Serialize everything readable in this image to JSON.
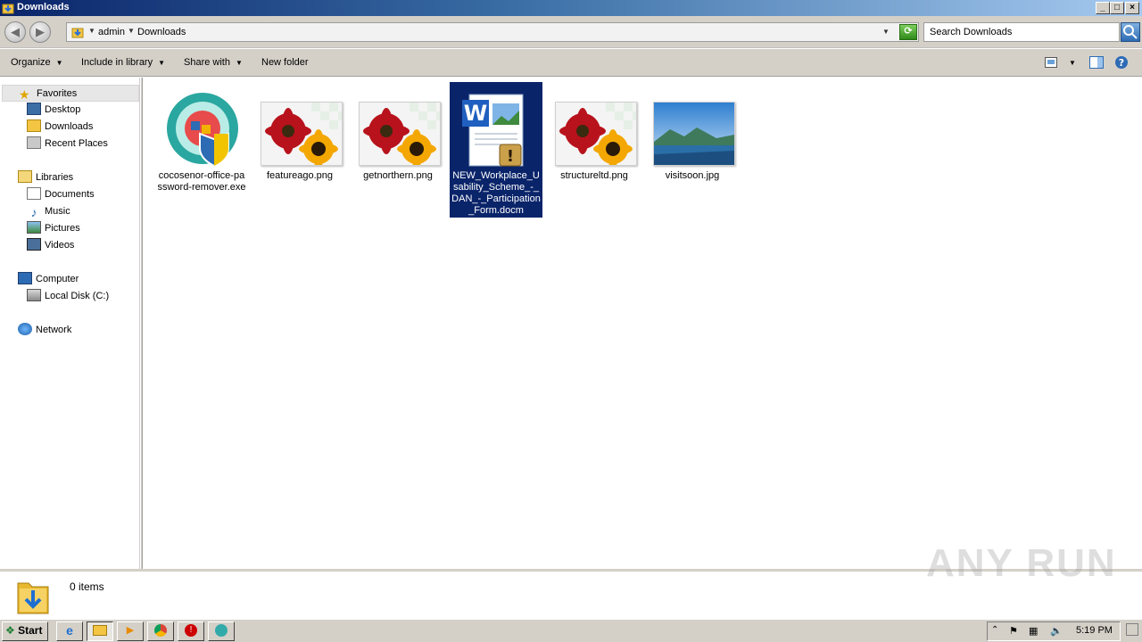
{
  "window": {
    "title": "Downloads"
  },
  "address": {
    "crumbs": [
      "admin",
      "Downloads"
    ],
    "search_placeholder": "Search Downloads"
  },
  "toolbar": {
    "organize": "Organize",
    "include": "Include in library",
    "share": "Share with",
    "new_folder": "New folder"
  },
  "nav": {
    "favorites": "Favorites",
    "desktop": "Desktop",
    "downloads": "Downloads",
    "recent": "Recent Places",
    "libraries": "Libraries",
    "documents": "Documents",
    "music": "Music",
    "pictures": "Pictures",
    "videos": "Videos",
    "computer": "Computer",
    "local_disk": "Local Disk (C:)",
    "network": "Network"
  },
  "files": [
    {
      "name": "cocosenor-office-password-remover.exe",
      "type": "exe"
    },
    {
      "name": "featureago.png",
      "type": "png"
    },
    {
      "name": "getnorthern.png",
      "type": "png"
    },
    {
      "name": "NEW_Workplace_Usability_Scheme_-_DAN_-_Participation_Form.docm",
      "type": "docm",
      "selected": true
    },
    {
      "name": "structureltd.png",
      "type": "png"
    },
    {
      "name": "visitsoon.jpg",
      "type": "jpg"
    }
  ],
  "status": {
    "count": "0 items"
  },
  "watermark": "ANY RUN",
  "taskbar": {
    "start": "Start",
    "clock": "5:19 PM"
  },
  "colors": {
    "selection": "#0a246a",
    "title_start": "#0a246a",
    "title_end": "#a6caf0"
  }
}
